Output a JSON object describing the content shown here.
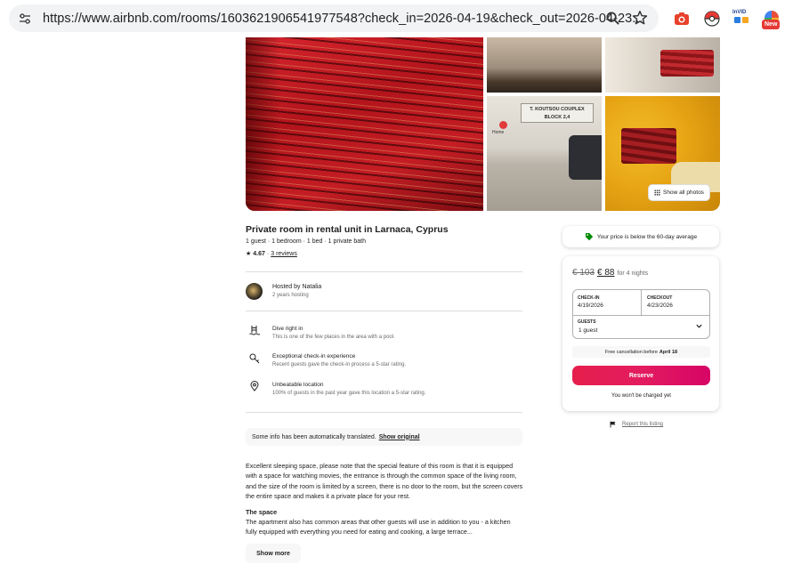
{
  "browser": {
    "url": "https://www.airbnb.com/rooms/1603621906541977548?check_in=2026-04-19&check_out=2026-04-23...",
    "extensions": [
      "camera-extension-icon",
      "pokeball-extension-icon",
      "invid-extension-icon",
      "new-extension-icon"
    ],
    "invid_label": "InVID",
    "new_badge": "New"
  },
  "gallery": {
    "show_all_label": "Show all photos",
    "street_sign": "T. KOUTSOU COUPLEX BLOCK 2,4",
    "street_marker_label": "Home"
  },
  "listing": {
    "title": "Private room in rental unit in Larnaca, Cyprus",
    "subtitle": "1 guest · 1 bedroom · 1 bed · 1 private bath",
    "rating_star": "★",
    "rating": "4.67",
    "rating_sep": "·",
    "reviews": "3 reviews"
  },
  "host": {
    "name": "Hosted by Natalia",
    "years": "2 years hosting"
  },
  "features": [
    {
      "icon": "pool-icon",
      "title": "Dive right in",
      "desc": "This is one of the few places in the area with a pool."
    },
    {
      "icon": "key-icon",
      "title": "Exceptional check-in experience",
      "desc": "Recent guests gave the check-in process a 5-star rating."
    },
    {
      "icon": "location-pin-icon",
      "title": "Unbeatable location",
      "desc": "100% of guests in the past year gave this location a 5-star rating."
    }
  ],
  "translation": {
    "text": "Some info has been automatically translated.",
    "link": "Show original"
  },
  "description": {
    "text": "Excellent sleeping space, please note that the special feature of this room is that it is equipped with a space for watching movies, the entrance is through the common space of the living room, and the size of the room is limited by a screen, there is no door to the room, but the screen covers the entire space and makes it a private place for your rest.",
    "space_title": "The space",
    "space_text": "The apartment also has common areas that other guests will use in addition to you - a kitchen fully equipped with everything you need for eating and cooking, a large terrace...",
    "show_more": "Show more"
  },
  "booking": {
    "price_note": "Your price is below the 60-day average",
    "price_old": "€ 103",
    "price_new": "€ 88",
    "price_suffix": "for 4 nights",
    "checkin_label": "CHECK-IN",
    "checkin_value": "4/19/2026",
    "checkout_label": "CHECKOUT",
    "checkout_value": "4/23/2026",
    "guests_label": "GUESTS",
    "guests_value": "1 guest",
    "cancel_text": "Free cancellation before",
    "cancel_date": "April 18",
    "reserve": "Reserve",
    "no_charge": "You won't be charged yet",
    "report": "Report this listing"
  },
  "colors": {
    "accent": "#e31c5f",
    "price_note_tag": "#008a05"
  }
}
